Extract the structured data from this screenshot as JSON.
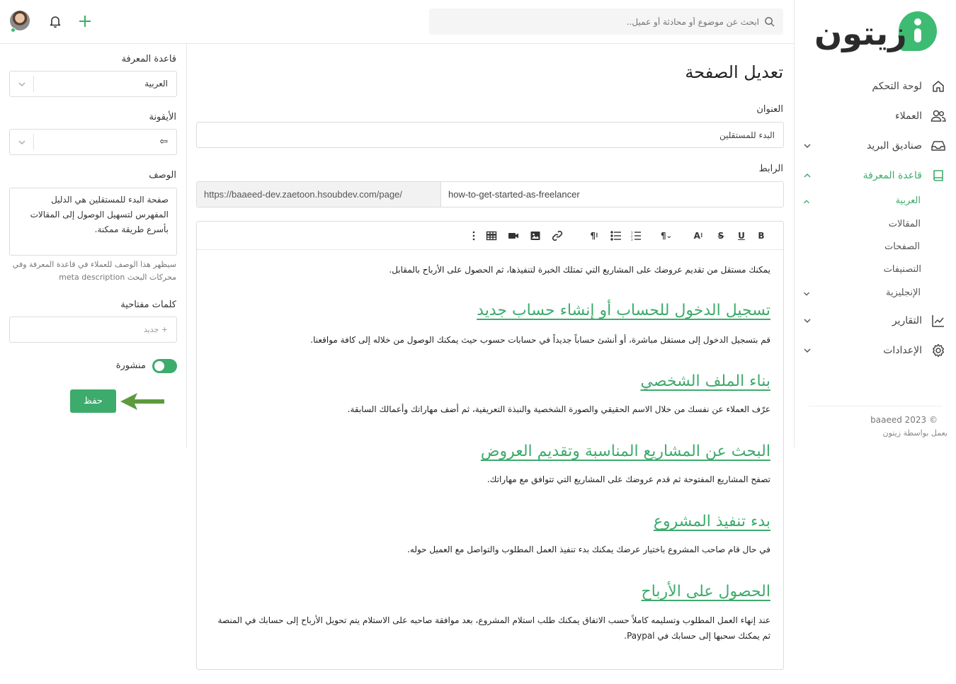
{
  "brand": {
    "logo_text": "زيتون",
    "accent": "#3dab6c"
  },
  "topbar": {
    "search_placeholder": "ابحث عن موضوع أو محادثة أو عميل..",
    "icons": [
      "avatar",
      "bell-icon",
      "plus-icon",
      "search-icon"
    ]
  },
  "sidebar": {
    "items": [
      {
        "label": "لوحة التحكم",
        "icon": "home-icon"
      },
      {
        "label": "العملاء",
        "icon": "users-icon"
      },
      {
        "label": "صناديق البريد",
        "icon": "inbox-icon"
      },
      {
        "label": "قاعدة المعرفة",
        "icon": "book-icon"
      },
      {
        "label": "التقارير",
        "icon": "chart-icon"
      },
      {
        "label": "الإعدادات",
        "icon": "gear-icon"
      }
    ],
    "kb_languages": {
      "arabic": "العربية",
      "english": "الإنجليزية"
    },
    "kb_sub": [
      "المقالات",
      "الصفحات",
      "التصنيفات"
    ],
    "copyright": "baaeed 2023 ©",
    "powered_by": "يعمل بواسطة زيتون"
  },
  "page": {
    "title": "تعديل الصفحة",
    "title_label": "العنوان",
    "title_value": "البدء للمستقلين",
    "link_label": "الرابط",
    "url_prefix": "https://baaeed-dev.zaetoon.hsoubdev.com/page/",
    "url_slug": "how-to-get-started-as-freelancer"
  },
  "editor": {
    "toolbar": [
      "B",
      "U",
      "S",
      "A",
      "¶",
      "bullets",
      "numbers",
      "¶",
      "link",
      "image",
      "video",
      "table",
      "more"
    ],
    "content": {
      "intro": "يمكنك مستقل من تقديم عروضك على المشاريع التي تمتلك الخبرة لتنفيذها، ثم الحصول على الأرباح بالمقابل.",
      "h1": "تسجيل الدخول للحساب أو إنشاء حساب جديد",
      "p1": "قم بتسجيل الدخول إلى مستقل مباشرة، أو أنشئ حساباً جديداً في حسابات حسوب حيث يمكنك الوصول من خلاله إلى كافة مواقعنا.",
      "h2": "بناء الملف الشخصي",
      "p2": "عرّف العملاء عن نفسك من خلال الاسم الحقيقي والصورة الشخصية والنبذة التعريفية، ثم أضف مهاراتك وأعمالك السابقة.",
      "h3": "البحث عن المشاريع المناسبة وتقديم العروض",
      "p3": "تصفح المشاريع المفتوحة ثم قدم عروضك على المشاريع التي تتوافق مع مهاراتك.",
      "h4": "بدء تنفيذ المشروع",
      "p4": "في حال قام صاحب المشروع باختيار عرضك يمكنك بدء تنفيذ العمل المطلوب والتواصل مع العميل حوله.",
      "h5": "الحصول على الأرباح",
      "p5": "عند إنهاء العمل المطلوب وتسليمه كاملاً حسب الاتفاق يمكنك طلب استلام المشروع، بعد موافقة صاحبه على الاستلام يتم تحويل الأرباح إلى حسابك في المنصة ثم يمكنك سحبها إلى حسابك في Paypal."
    }
  },
  "settings": {
    "kb_label": "قاعدة المعرفة",
    "kb_value": "العربية",
    "icon_label": "الأيقونة",
    "icon_value": "⇦",
    "desc_label": "الوصف",
    "desc_value": "صفحة البدء للمستقلين هي الدليل المفهرس لتسهيل الوصول إلى المقالات بأسرع طريقة ممكنة.",
    "desc_hint": "سيظهر هذا الوصف للعملاء في قاعدة المعرفة وفي محركات البحث meta description",
    "keywords_label": "كلمات مفتاحية",
    "keywords_placeholder": "+ جديد",
    "published_label": "منشورة",
    "published": true,
    "save_label": "حفظ"
  }
}
